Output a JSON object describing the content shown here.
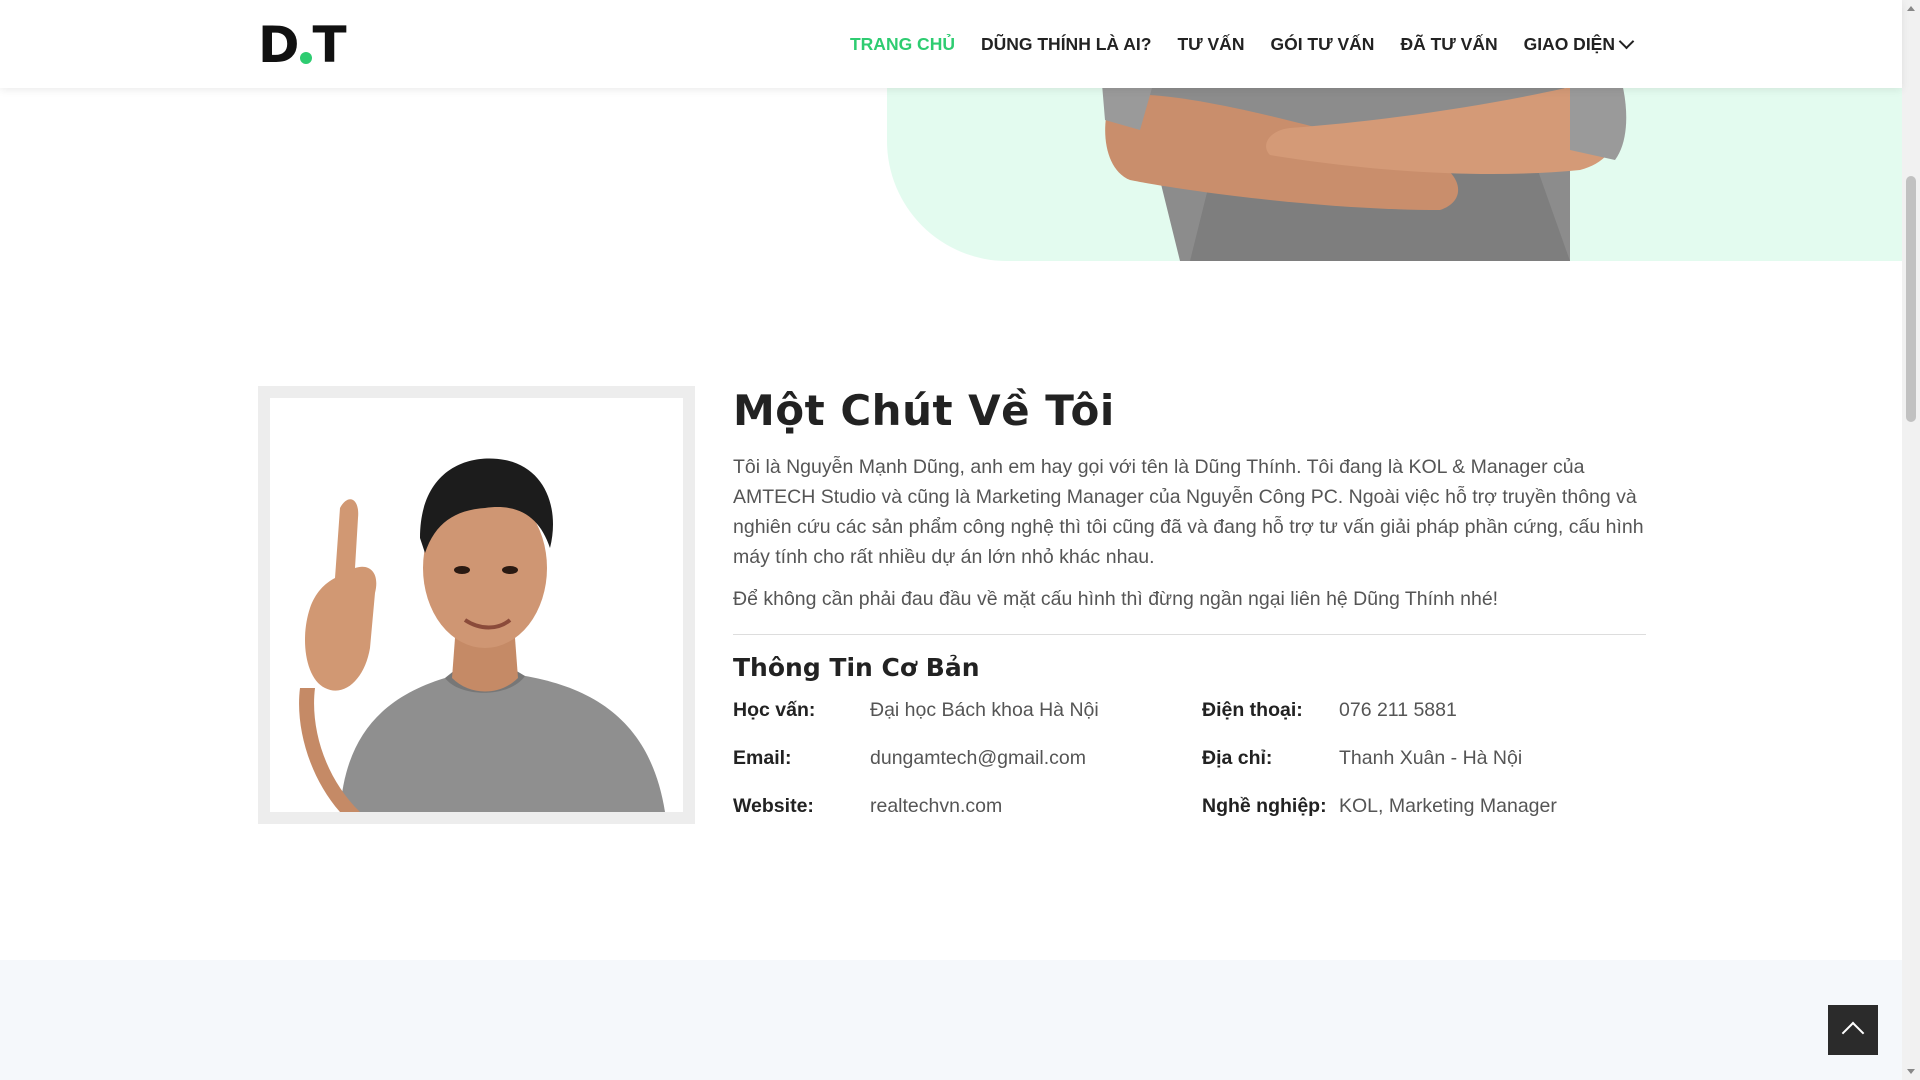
{
  "header": {
    "logo_left": "D",
    "logo_right": "T",
    "nav": [
      {
        "label": "TRANG CHỦ",
        "active": true
      },
      {
        "label": "DŨNG THÍNH LÀ AI?"
      },
      {
        "label": "TƯ VẤN"
      },
      {
        "label": "GÓI TƯ VẤN"
      },
      {
        "label": "ĐÃ TƯ VẤN"
      },
      {
        "label": "GIAO DIỆN",
        "has_dropdown": true
      }
    ]
  },
  "about": {
    "title": "Một Chút Về Tôi",
    "para1": "Tôi là Nguyễn Mạnh Dũng, anh em hay gọi với tên là Dũng Thính. Tôi đang là KOL & Manager của AMTECH Studio và cũng là Marketing Manager của Nguyễn Công PC. Ngoài việc hỗ trợ truyền thông và nghiên cứu các sản phẩm công nghệ thì tôi cũng đã và đang hỗ trợ tư vấn giải pháp phần cứng, cấu hình máy tính cho rất nhiều dự án lớn nhỏ khác nhau.",
    "para2": "Để không cần phải đau đầu về mặt cấu hình thì đừng ngần ngại liên hệ Dũng Thính nhé!",
    "info_title": "Thông Tin Cơ Bản",
    "info": {
      "education_label": "Học vấn:",
      "education_value": "Đại học Bách khoa Hà Nội",
      "phone_label": "Điện thoại:",
      "phone_value": "076 211 5881",
      "email_label": "Email:",
      "email_value": "dungamtech@gmail.com",
      "address_label": "Địa chỉ:",
      "address_value": "Thanh Xuân - Hà Nội",
      "website_label": "Website:",
      "website_value": "realtechvn.com",
      "job_label": "Nghề nghiệp:",
      "job_value": "KOL, Marketing Manager"
    }
  },
  "colors": {
    "accent": "#2ecc71",
    "hero_bg": "#e3fbef",
    "back_to_top_bg": "#2b2b2b"
  },
  "icons": {
    "dropdown": "chevron-down-icon",
    "back_to_top": "chevron-up-icon"
  }
}
